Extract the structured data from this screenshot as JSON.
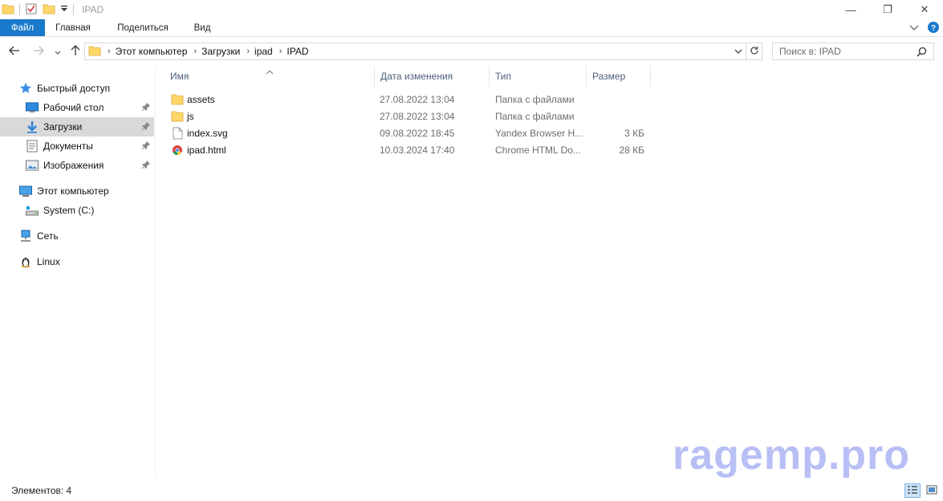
{
  "window": {
    "title": "IPAD",
    "minimize": "—",
    "restore": "❐",
    "close": "✕"
  },
  "ribbon": {
    "tabs": [
      {
        "label": "Файл"
      },
      {
        "label": "Главная"
      },
      {
        "label": "Поделиться"
      },
      {
        "label": "Вид"
      }
    ]
  },
  "address": {
    "crumbs": [
      "Этот компьютер",
      "Загрузки",
      "ipad",
      "IPAD"
    ]
  },
  "search": {
    "placeholder": "Поиск в: IPAD"
  },
  "sidebar": {
    "items": [
      {
        "label": "Быстрый доступ",
        "icon": "star-icon"
      },
      {
        "label": "Рабочий стол",
        "icon": "desktop-icon",
        "pinned": true
      },
      {
        "label": "Загрузки",
        "icon": "downloads-icon",
        "pinned": true,
        "selected": true
      },
      {
        "label": "Документы",
        "icon": "documents-icon",
        "pinned": true
      },
      {
        "label": "Изображения",
        "icon": "pictures-icon",
        "pinned": true
      },
      {
        "label": "Этот компьютер",
        "icon": "computer-icon"
      },
      {
        "label": "System (C:)",
        "icon": "drive-icon"
      },
      {
        "label": "Сеть",
        "icon": "network-icon"
      },
      {
        "label": "Linux",
        "icon": "linux-icon"
      }
    ]
  },
  "columns": {
    "name": "Имя",
    "date": "Дата изменения",
    "type": "Тип",
    "size": "Размер"
  },
  "files": [
    {
      "name": "assets",
      "date": "27.08.2022 13:04",
      "type": "Папка с файлами",
      "size": "",
      "icon": "folder-icon"
    },
    {
      "name": "js",
      "date": "27.08.2022 13:04",
      "type": "Папка с файлами",
      "size": "",
      "icon": "folder-icon"
    },
    {
      "name": "index.svg",
      "date": "09.08.2022 18:45",
      "type": "Yandex Browser H...",
      "size": "3 КБ",
      "icon": "svg-file-icon"
    },
    {
      "name": "ipad.html",
      "date": "10.03.2024 17:40",
      "type": "Chrome HTML Do...",
      "size": "28 КБ",
      "icon": "chrome-file-icon"
    }
  ],
  "status": {
    "count": "Элементов: 4"
  },
  "watermark": {
    "text": "ragemp.pro"
  },
  "colors": {
    "accent": "#1979ca",
    "folder": "#ffd769",
    "selected": "#d9d9d9",
    "header_text": "#4c607a",
    "watermark": "#b8bff5"
  }
}
